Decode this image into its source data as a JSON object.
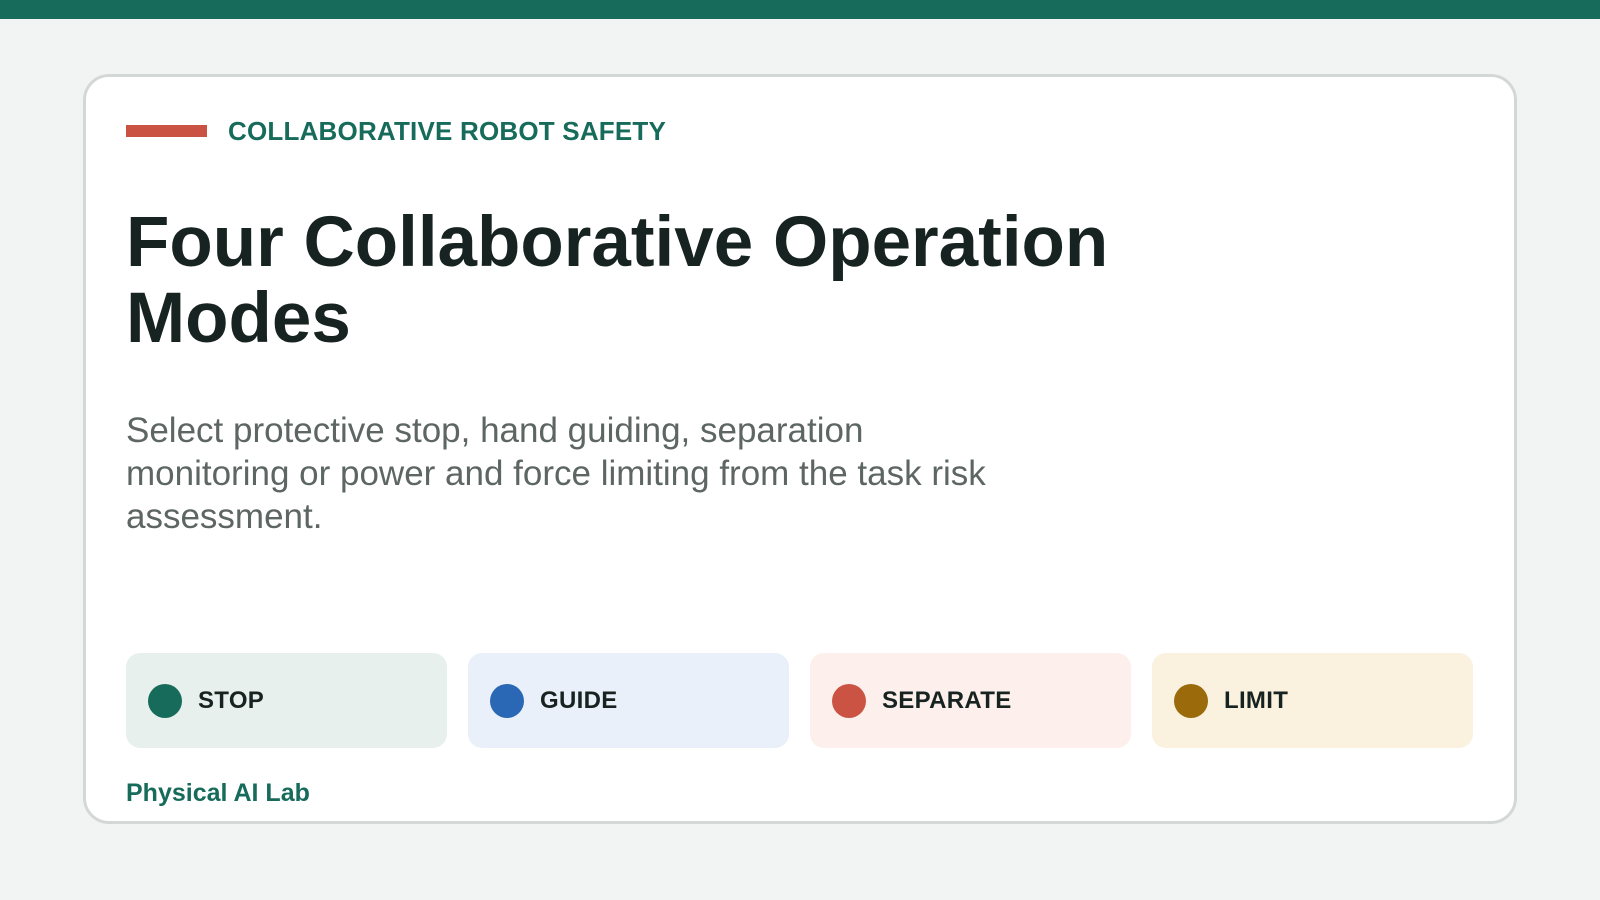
{
  "eyebrow": "COLLABORATIVE ROBOT SAFETY",
  "title": "Four Collaborative Operation Modes",
  "subtitle": "Select protective stop, hand guiding, separation monitoring or power and force limiting from the task risk assessment.",
  "modes": [
    {
      "label": "STOP",
      "dot_color": "#176b5a",
      "bg_color": "#e8f0ed"
    },
    {
      "label": "GUIDE",
      "dot_color": "#2a67b4",
      "bg_color": "#e9f0f9"
    },
    {
      "label": "SEPARATE",
      "dot_color": "#cb5343",
      "bg_color": "#fdefeb"
    },
    {
      "label": "LIMIT",
      "dot_color": "#9a6a0b",
      "bg_color": "#faf1df"
    }
  ],
  "footer": "Physical AI Lab",
  "colors": {
    "accent": "#176b5a",
    "rule": "#c95242",
    "title": "#172320",
    "subtitle": "#5d6663"
  }
}
